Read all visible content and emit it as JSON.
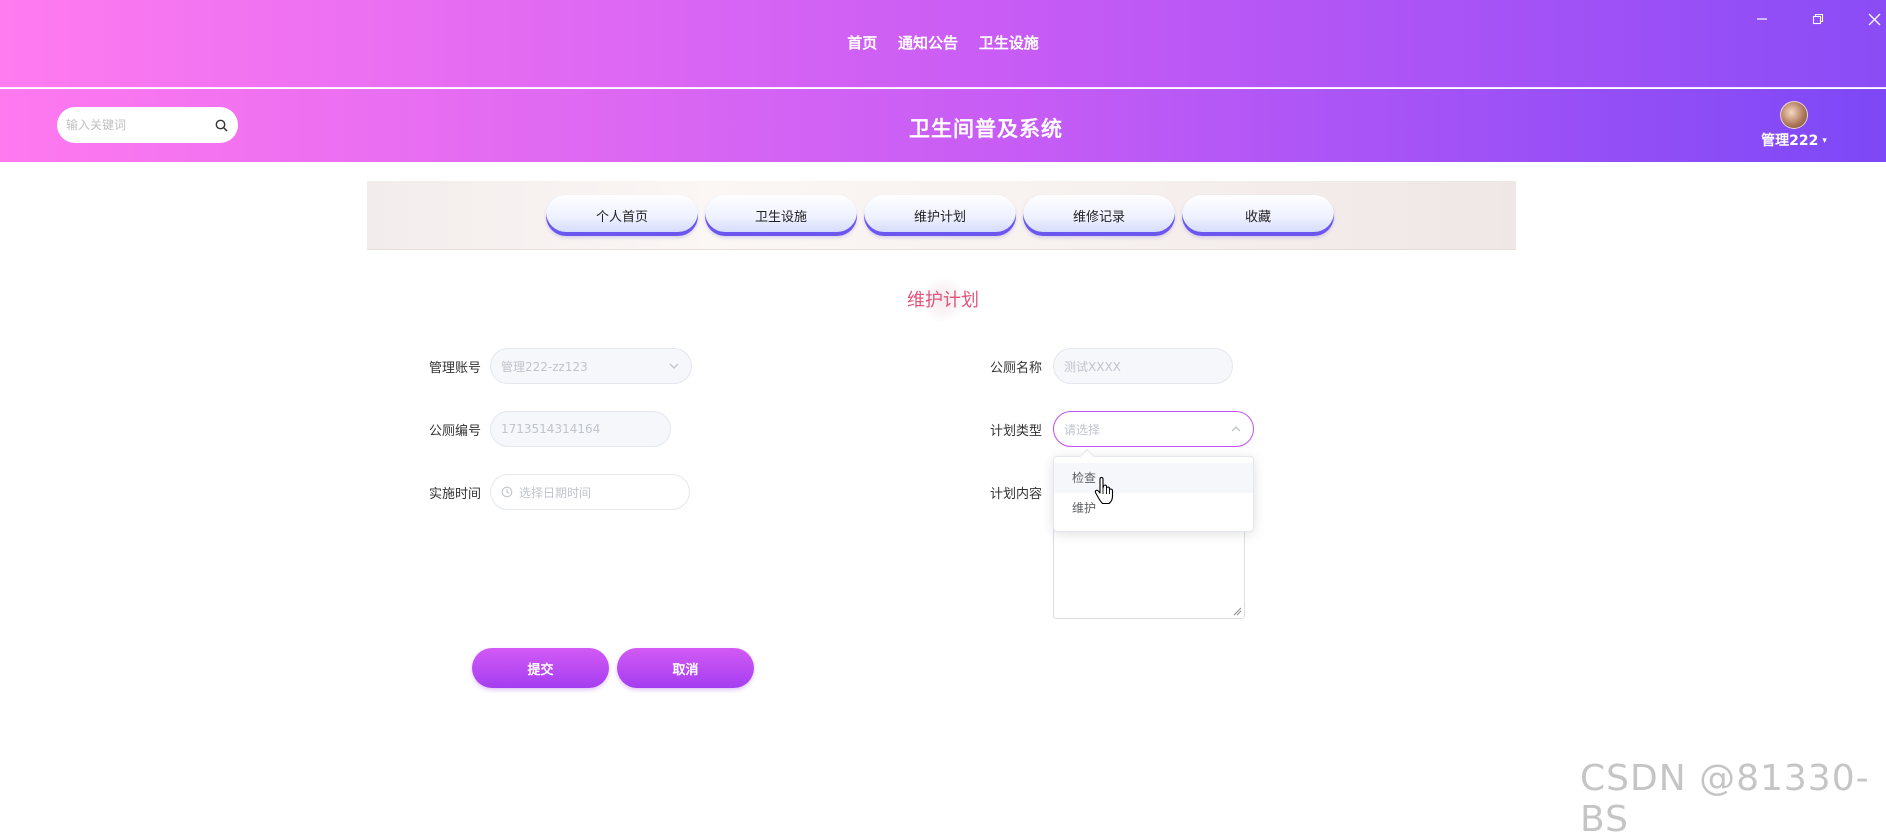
{
  "topnav": {
    "items": [
      "首页",
      "通知公告",
      "卫生设施"
    ]
  },
  "window": {
    "minimize_icon": "minimize-icon",
    "restore_icon": "restore-icon",
    "close_icon": "close-icon"
  },
  "header": {
    "search_placeholder": "输入关键词",
    "site_title": "卫生间普及系统",
    "user_name": "管理222",
    "caret": "▾"
  },
  "tabs": [
    "个人首页",
    "卫生设施",
    "维护计划",
    "维修记录",
    "收藏"
  ],
  "form": {
    "title": "维护计划",
    "account": {
      "label": "管理账号",
      "value": "管理222-zz123"
    },
    "toilet_name": {
      "label": "公厕名称",
      "value": "测试XXXX"
    },
    "toilet_no": {
      "label": "公厕编号",
      "value": "1713514314164"
    },
    "plan_type": {
      "label": "计划类型",
      "placeholder": "请选择",
      "options": [
        "检查",
        "维护"
      ],
      "hovered": "检查"
    },
    "impl_time": {
      "label": "实施时间",
      "placeholder": "选择日期时间"
    },
    "plan_content": {
      "label": "计划内容",
      "value": ""
    },
    "submit_label": "提交",
    "cancel_label": "取消"
  },
  "watermark": "CSDN @81330-BS",
  "colors": {
    "accent": "#c24ff4",
    "title_red": "#e0557a",
    "gradient_start": "#ff7bf0",
    "gradient_end": "#8a4cf6"
  }
}
